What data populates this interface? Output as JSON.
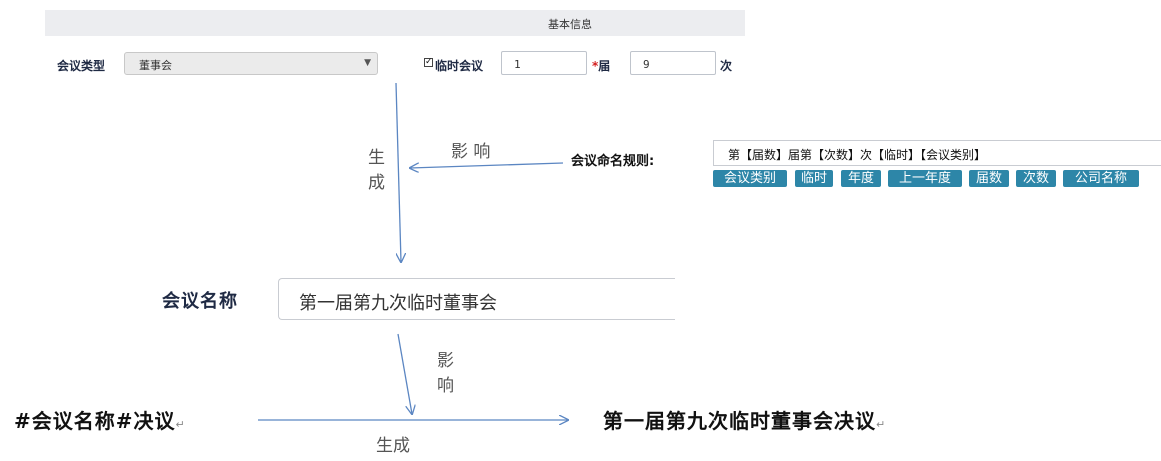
{
  "form": {
    "header_title": "基本信息",
    "meeting_type_label": "会议类型",
    "meeting_type_value": "董事会",
    "temp_meeting_label": "临时会议",
    "session_value": "1",
    "session_required_mark": "*",
    "session_unit": "届",
    "count_value": "9",
    "count_unit": "次"
  },
  "naming_rule": {
    "label": "会议命名规则:",
    "value": "第【届数】届第【次数】次【临时】【会议类别】",
    "tags": [
      "会议类别",
      "临时",
      "年度",
      "上一年度",
      "届数",
      "次数",
      "公司名称"
    ]
  },
  "meeting_name": {
    "label": "会议名称",
    "value": "第一届第九次临时董事会"
  },
  "template": {
    "source": "#会议名称#决议",
    "result": "第一届第九次临时董事会决议",
    "para_mark": "↵"
  },
  "annotations": {
    "influence_1": "影 响",
    "generate_1_line1": "生",
    "generate_1_line2": "成",
    "influence_2_line1": "影",
    "influence_2_line2": "响",
    "generate_2": "生成"
  },
  "colors": {
    "arrow": "#5b86c2",
    "tag_bg": "#2d86a8",
    "required": "#d42020"
  }
}
